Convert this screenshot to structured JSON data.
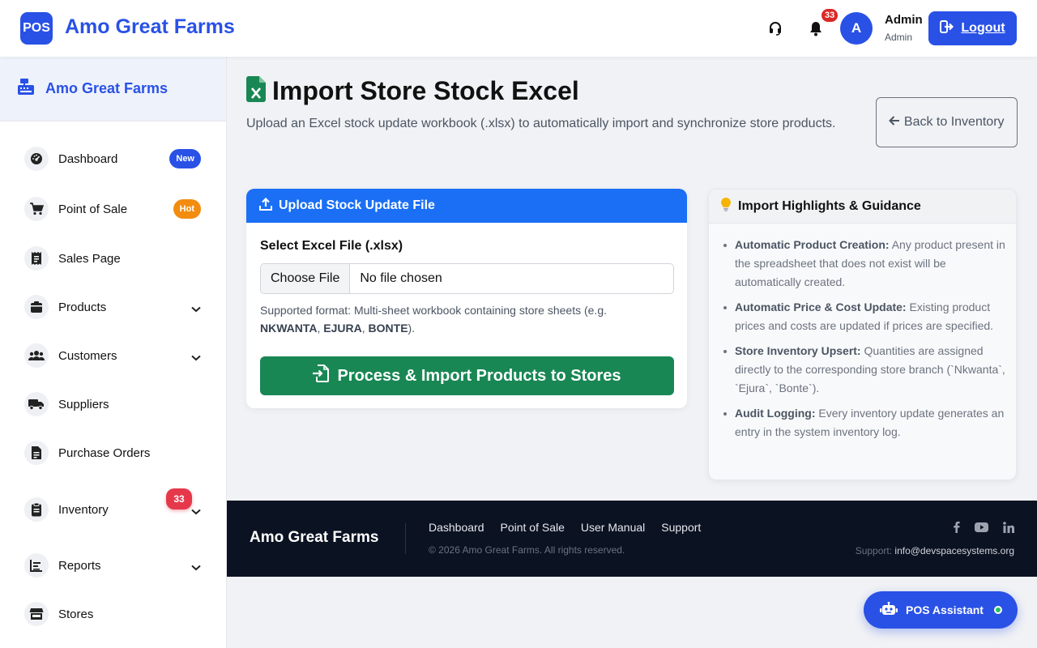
{
  "header": {
    "logo_text": "POS",
    "brand": "Amo Great Farms",
    "notification_count": "33",
    "avatar_initial": "A",
    "user_name": "Admin",
    "user_role": "Admin",
    "logout_label": "Logout",
    "accent_color": "#2951e6"
  },
  "sidebar": {
    "title": "Amo Great Farms",
    "items": [
      {
        "label": "Dashboard",
        "icon": "gauge-icon",
        "badge": "New",
        "badge_color": "#2951e6"
      },
      {
        "label": "Point of Sale",
        "icon": "cart-icon",
        "badge": "Hot",
        "badge_color": "#f28c0f"
      },
      {
        "label": "Sales Page",
        "icon": "receipt-icon"
      },
      {
        "label": "Products",
        "icon": "box-icon",
        "has_submenu": true
      },
      {
        "label": "Customers",
        "icon": "users-icon",
        "has_submenu": true
      },
      {
        "label": "Suppliers",
        "icon": "truck-icon"
      },
      {
        "label": "Purchase Orders",
        "icon": "file-invoice-icon"
      },
      {
        "label": "Inventory",
        "icon": "clipboard-icon",
        "has_submenu": true,
        "count": "33"
      },
      {
        "label": "Reports",
        "icon": "chart-icon",
        "has_submenu": true
      },
      {
        "label": "Stores",
        "icon": "store-icon"
      }
    ]
  },
  "page": {
    "title": "Import Store Stock Excel",
    "subtitle": "Upload an Excel stock update workbook (.xlsx) to automatically import and synchronize store products.",
    "back_button": "Back to Inventory"
  },
  "upload": {
    "header": "Upload Stock Update File",
    "field_label": "Select Excel File (.xlsx)",
    "choose_label": "Choose File",
    "file_value": "No file chosen",
    "help_prefix": "Supported format: Multi-sheet workbook containing store sheets (e.g. ",
    "sheets": [
      "NKWANTA",
      "EJURA",
      "BONTE"
    ],
    "sep1": ", ",
    "sep2": ", ",
    "help_suffix": ").",
    "process_button": "Process & Import Products to Stores",
    "header_color": "#1a6ff5",
    "button_color": "#198754"
  },
  "guidance": {
    "header": "Import Highlights & Guidance",
    "items": [
      {
        "title": "Automatic Product Creation:",
        "text": " Any product present in the spreadsheet that does not exist will be automatically created."
      },
      {
        "title": "Automatic Price & Cost Update:",
        "text": " Existing product prices and costs are updated if prices are specified."
      },
      {
        "title": "Store Inventory Upsert:",
        "text": " Quantities are assigned directly to the corresponding store branch (`Nkwanta`, `Ejura`, `Bonte`)."
      },
      {
        "title": "Audit Logging:",
        "text": " Every inventory update generates an entry in the system inventory log."
      }
    ]
  },
  "footer": {
    "brand": "Amo Great Farms",
    "links": [
      "Dashboard",
      "Point of Sale",
      "User Manual",
      "Support"
    ],
    "copyright": "© 2026 Amo Great Farms. All rights reserved.",
    "support_label": "Support:",
    "support_email": "info@devspacesystems.org",
    "social": [
      "facebook-icon",
      "youtube-icon",
      "linkedin-icon"
    ]
  },
  "assistant": {
    "label": "POS Assistant"
  }
}
